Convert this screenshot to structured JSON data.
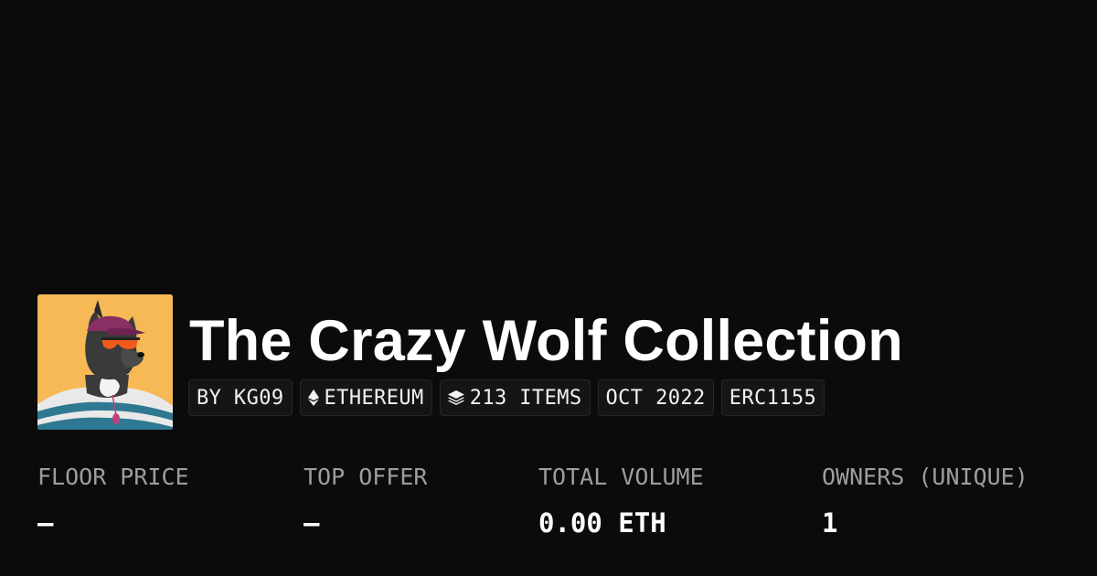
{
  "collection": {
    "title": "The Crazy Wolf Collection",
    "avatar_icon": "wolf-avatar"
  },
  "chips": [
    {
      "label": "BY KG09",
      "icon": ""
    },
    {
      "label": "ETHEREUM",
      "icon": "ethereum-icon"
    },
    {
      "label": "213 ITEMS",
      "icon": "layers-icon"
    },
    {
      "label": "OCT 2022",
      "icon": ""
    },
    {
      "label": "ERC1155",
      "icon": ""
    }
  ],
  "stats": [
    {
      "label": "FLOOR PRICE",
      "value": "–"
    },
    {
      "label": "TOP OFFER",
      "value": "–"
    },
    {
      "label": "TOTAL VOLUME",
      "value": "0.00 ETH"
    },
    {
      "label": "OWNERS (UNIQUE)",
      "value": "1"
    }
  ],
  "colors": {
    "background": "#0b0b0b",
    "avatar_background": "#f7b955",
    "label_gray": "#9e9e9e",
    "chip_background": "#151515"
  }
}
